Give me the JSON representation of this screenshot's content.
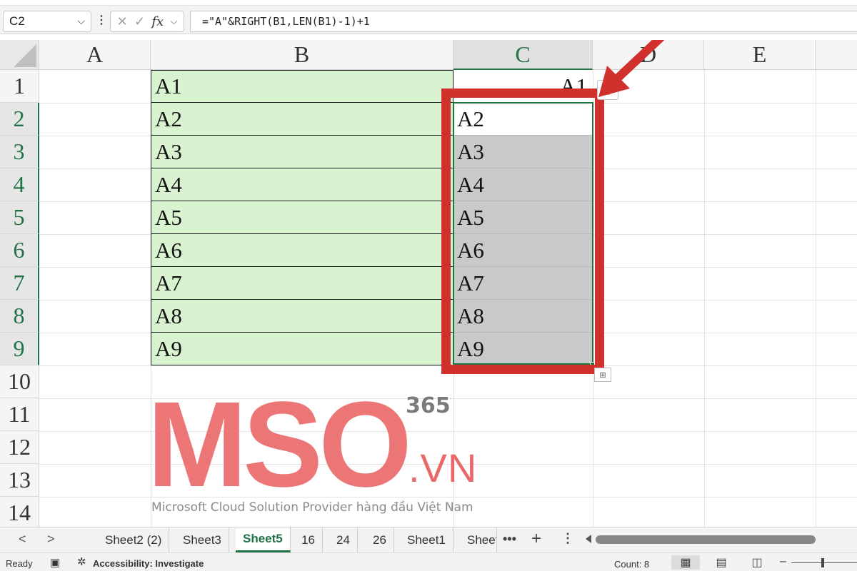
{
  "formula_bar": {
    "name_box": "C2",
    "formula": "=\"A\"&RIGHT(B1,LEN(B1)-1)+1",
    "fx_label": "fx",
    "cancel_glyph": "✕",
    "confirm_glyph": "✓"
  },
  "columns": [
    "A",
    "B",
    "C",
    "D",
    "E"
  ],
  "rows": [
    "1",
    "2",
    "3",
    "4",
    "5",
    "6",
    "7",
    "8",
    "9",
    "10",
    "11",
    "12",
    "13",
    "14"
  ],
  "column_b": [
    "A1",
    "A2",
    "A3",
    "A4",
    "A5",
    "A6",
    "A7",
    "A8",
    "A9"
  ],
  "column_c": [
    "A1",
    "A2",
    "A3",
    "A4",
    "A5",
    "A6",
    "A7",
    "A8",
    "A9"
  ],
  "active_cell": "C2",
  "watermark": {
    "brand_label": "365",
    "domain": ".VN",
    "tagline": "Microsoft Cloud Solution Provider hàng đầu Việt Nam",
    "logo_text": "MSO"
  },
  "sheet_tabs": {
    "tabs": [
      "Sheet2 (2)",
      "Sheet3",
      "Sheet5",
      "16",
      "24",
      "26",
      "Sheet1",
      "Sheet"
    ],
    "active": "Sheet5",
    "more": "•••",
    "add": "+",
    "options": "⋮"
  },
  "status_bar": {
    "ready": "Ready",
    "accessibility": "Accessibility: Investigate",
    "count": "Count: 8",
    "zoom_minus": "–"
  },
  "colors": {
    "excel_green": "#217346",
    "highlight_fill": "#d9f2d0",
    "selection_fill": "#c9c9c9",
    "annotation_red": "#d0312d",
    "watermark_pink": "#e9696a"
  }
}
